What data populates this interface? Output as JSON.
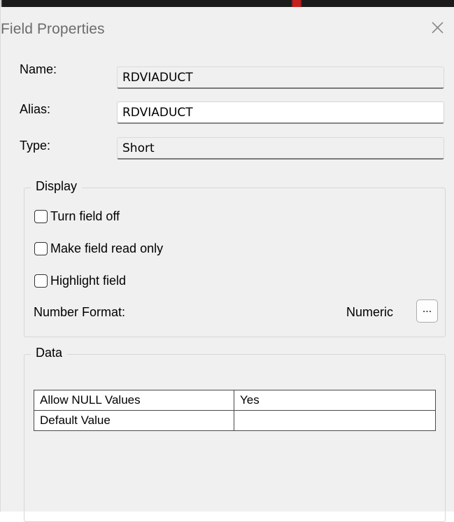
{
  "window": {
    "title": "Field Properties"
  },
  "fields": {
    "name_label": "Name:",
    "name_value": "RDVIADUCT",
    "alias_label": "Alias:",
    "alias_value": "RDVIADUCT",
    "type_label": "Type:",
    "type_value": "Short"
  },
  "display": {
    "title": "Display",
    "turn_off": "Turn field off",
    "read_only": "Make field read only",
    "highlight": "Highlight field",
    "number_format_label": "Number Format:",
    "number_format_value": "Numeric",
    "ellipsis": "..."
  },
  "data": {
    "title": "Data",
    "rows": [
      {
        "property": "Allow NULL Values",
        "value": "Yes"
      },
      {
        "property": "Default Value",
        "value": ""
      }
    ]
  },
  "icons": {
    "close": "close-icon",
    "checkbox": "checkbox-unchecked"
  },
  "colors": {
    "dialog_background": "#f0f0f0",
    "title_text": "#6c6c6c"
  }
}
